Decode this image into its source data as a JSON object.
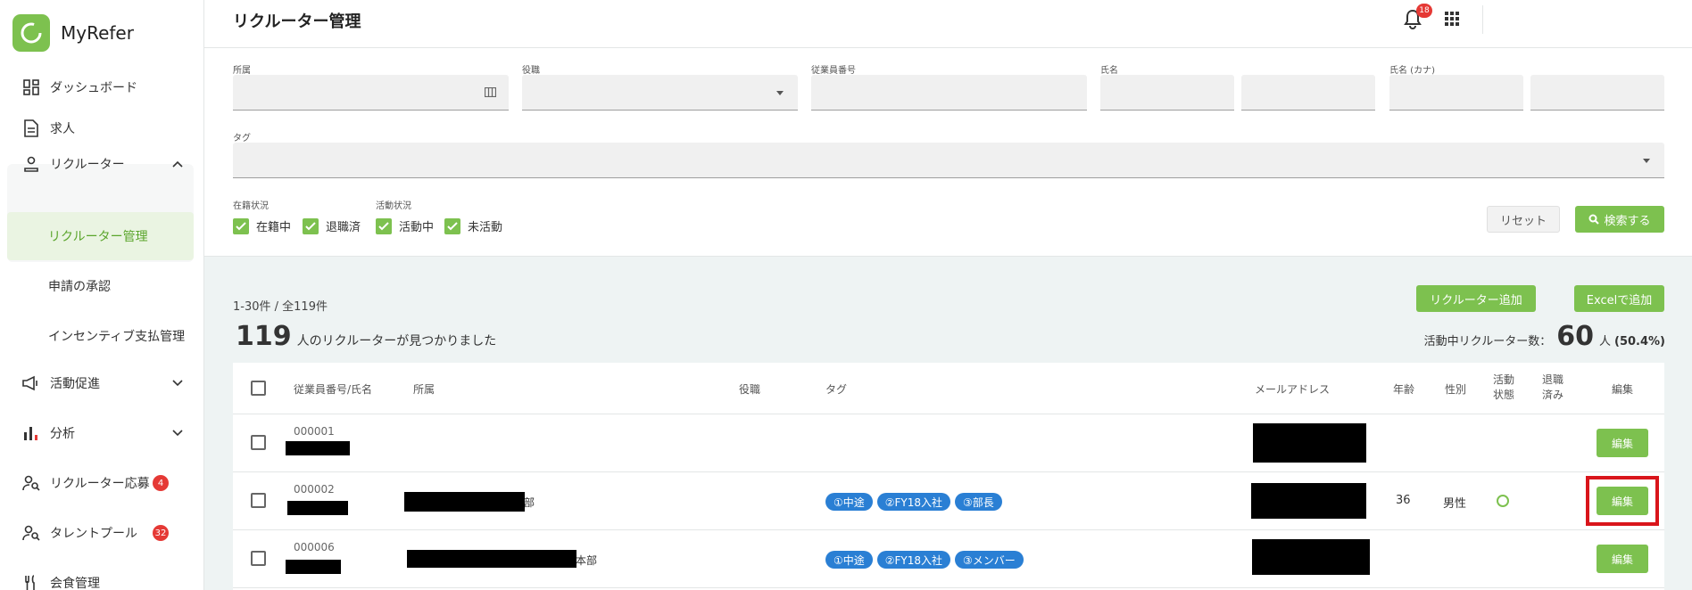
{
  "app": {
    "name": "MyRefer"
  },
  "sidebar": {
    "items": [
      {
        "label": "ダッシュボード"
      },
      {
        "label": "求人"
      },
      {
        "label": "リクルーター"
      },
      {
        "label": "リクルーター管理"
      },
      {
        "label": "申請の承認"
      },
      {
        "label": "インセンティブ支払管理"
      },
      {
        "label": "活動促進"
      },
      {
        "label": "分析"
      },
      {
        "label": "リクルーター応募",
        "badge": "4"
      },
      {
        "label": "タレントプール",
        "badge": "32"
      },
      {
        "label": "会食管理"
      }
    ]
  },
  "header": {
    "title": "リクルーター管理",
    "notification_count": "18"
  },
  "filters": {
    "affiliation_label": "所属",
    "position_label": "役職",
    "employee_no_label": "従業員番号",
    "name_label": "氏名",
    "kana_label": "氏名 (カナ)",
    "tag_label": "タグ",
    "enrollment_label": "在籍状況",
    "activity_label": "活動状況",
    "enrollment_options": [
      "在籍中",
      "退職済"
    ],
    "activity_options": [
      "活動中",
      "未活動"
    ],
    "reset_label": "リセット",
    "search_label": "検索する"
  },
  "results": {
    "range_text": "1-30件 / 全119件",
    "add_recruiter_label": "リクルーター追加",
    "excel_add_label": "Excelで追加",
    "total": "119",
    "found_text": "人のリクルーターが見つかりました",
    "active_label": "活動中リクルーター数：",
    "active_count": "60",
    "active_suffix": "人",
    "active_ratio": "(50.4%)"
  },
  "table": {
    "headers": {
      "emp_name": "従業員番号/氏名",
      "affiliation": "所属",
      "position": "役職",
      "tag": "タグ",
      "email": "メールアドレス",
      "age": "年齢",
      "gender": "性別",
      "activity_l1": "活動",
      "activity_l2": "状態",
      "retired_l1": "退職",
      "retired_l2": "済み",
      "edit": "編集"
    },
    "rows": [
      {
        "emp_no": "000001",
        "dept_suffix": "",
        "tags": [],
        "age": "",
        "gender": "",
        "active": false,
        "edit": "編集"
      },
      {
        "emp_no": "000002",
        "dept_suffix": "部",
        "tags": [
          "①中途",
          "②FY18入社",
          "③部長"
        ],
        "age": "36",
        "gender": "男性",
        "active": true,
        "edit": "編集"
      },
      {
        "emp_no": "000006",
        "dept_suffix": "本部",
        "tags": [
          "①中途",
          "②FY18入社",
          "③メンバー"
        ],
        "age": "",
        "gender": "",
        "active": false,
        "edit": "編集"
      }
    ]
  },
  "colors": {
    "accent": "#7dc14f",
    "tag": "#2a7fd4",
    "badge": "#e53935",
    "highlight": "#d9151b"
  }
}
